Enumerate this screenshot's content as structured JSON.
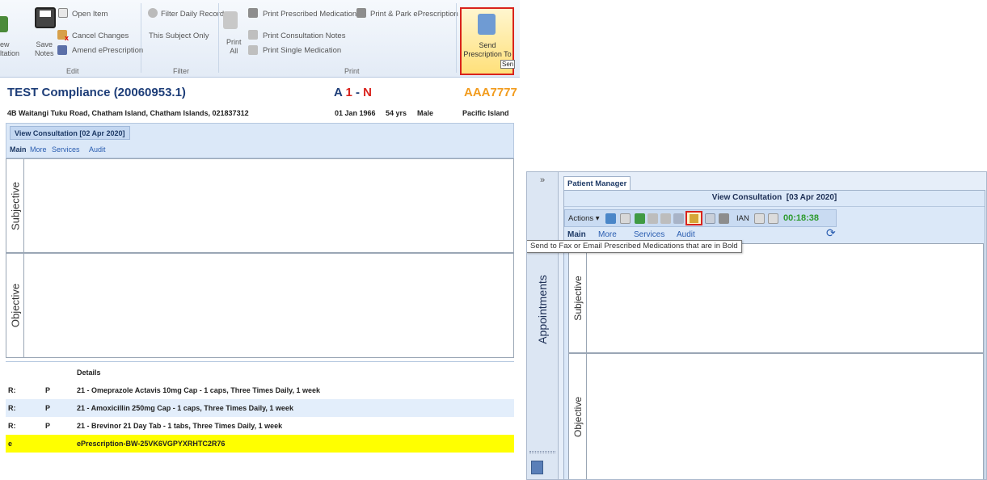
{
  "left": {
    "ribbon": {
      "new_consultation_frag": "ew\nltation",
      "save_notes": "Save\nNotes",
      "open_item": "Open Item",
      "cancel_changes": "Cancel Changes",
      "amend_eprescription": "Amend ePrescription",
      "group_edit": "Edit",
      "filter_daily_record": "Filter Daily Record",
      "this_subject_only": "This Subject Only",
      "group_filter": "Filter",
      "print_all": "Print\nAll",
      "print_prescribed": "Print Prescribed Medications",
      "print_park": "Print & Park ePrescription",
      "print_consultation_notes": "Print Consultation Notes",
      "print_single_medication": "Print Single Medication",
      "group_print": "Print",
      "send_prescription": "Send\nPrescription To",
      "send_tooltip_frag": "Sen"
    },
    "patient": {
      "name": "TEST Compliance (20060953.1)",
      "flag_a": "A",
      "flag_1": "1",
      "flag_dash": "-",
      "flag_n": "N",
      "code": "AAA7777",
      "address": "4B Waitangi Tuku Road, Chatham Island, Chatham Islands, 021837312",
      "dob": "01 Jan 1966",
      "age": "54 yrs",
      "sex": "Male",
      "ethnicity": "Pacific Island"
    },
    "consult_tab": "View Consultation [02 Apr 2020]",
    "subtabs": [
      "Main",
      "More",
      "Services",
      "Audit"
    ],
    "subjective_label": "Subjective",
    "objective_label": "Objective",
    "grid": {
      "details_header": "Details",
      "rows": [
        {
          "col1": "R:",
          "col2": "P",
          "details": "21 - Omeprazole Actavis 10mg Cap - 1 caps, Three Times Daily, 1 week"
        },
        {
          "col1": "R:",
          "col2": "P",
          "details": "21 - Amoxicillin 250mg Cap - 1 caps, Three Times Daily, 1 week"
        },
        {
          "col1": "R:",
          "col2": "P",
          "details": "21 - Brevinor 21 Day Tab - 1 tabs, Three Times Daily, 1 week"
        },
        {
          "col1": "e",
          "col2": "",
          "details": "ePrescription-BW-25VK6VGPYXRHTC2R76"
        }
      ]
    }
  },
  "right": {
    "collapse": "»",
    "tab_patient_manager": "Patient Manager",
    "consult_title": "View Consultation  [03 Apr 2020]",
    "actions": "Actions",
    "ian": "IAN",
    "timer": "00:18:38",
    "subtabs": [
      "Main",
      "More",
      "Services",
      "Audit"
    ],
    "tooltip": "Send to Fax or Email Prescribed Medications that are in Bold",
    "appointments": "Appointments",
    "subjective_label": "Subjective",
    "objective_label": "Objective"
  },
  "colors": {
    "accent_red": "#d9231d",
    "code_orange": "#f29b1c",
    "highlight_yellow": "#ffff00",
    "timer_green": "#2e9b2e",
    "header_blue": "#1d3d78"
  }
}
